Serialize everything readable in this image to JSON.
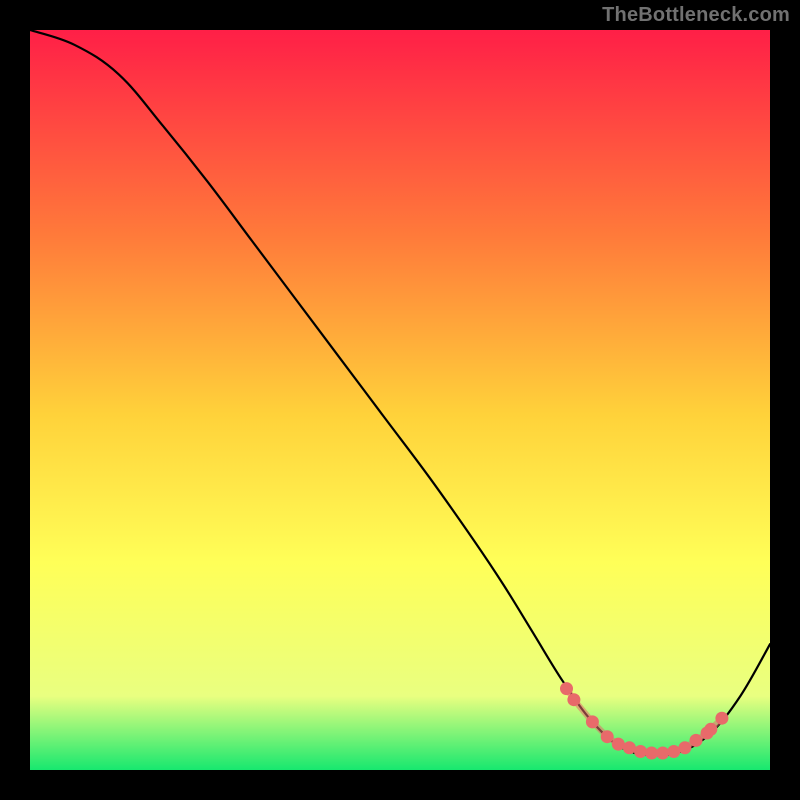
{
  "watermark": "TheBottleneck.com",
  "colors": {
    "background": "#000000",
    "gradient_top": "#ff1f47",
    "gradient_mid1": "#ff7b3a",
    "gradient_mid2": "#ffd23a",
    "gradient_mid3": "#ffff58",
    "gradient_mid4": "#e9ff80",
    "gradient_bottom": "#17e86f",
    "curve": "#000000",
    "dot": "#e86a6a"
  },
  "chart_data": {
    "type": "line",
    "title": "",
    "xlabel": "",
    "ylabel": "",
    "xlim": [
      0,
      100
    ],
    "ylim": [
      0,
      100
    ],
    "legend": false,
    "grid": false,
    "series": [
      {
        "name": "bottleneck-curve",
        "x": [
          0,
          6,
          12,
          18,
          24,
          30,
          36,
          42,
          48,
          54,
          60,
          64,
          68,
          72,
          76,
          80,
          84,
          88,
          92,
          96,
          100
        ],
        "y": [
          100,
          98,
          94,
          87,
          79.5,
          71.5,
          63.5,
          55.5,
          47.5,
          39.5,
          31,
          25,
          18.5,
          12,
          6.5,
          3,
          2,
          2.5,
          5,
          10,
          17
        ]
      }
    ],
    "annotations": [
      {
        "name": "highlight-dots",
        "points": [
          {
            "x": 72.5,
            "y": 11
          },
          {
            "x": 73.5,
            "y": 9.5
          },
          {
            "x": 76,
            "y": 6.5
          },
          {
            "x": 78,
            "y": 4.5
          },
          {
            "x": 79.5,
            "y": 3.5
          },
          {
            "x": 81,
            "y": 3
          },
          {
            "x": 82.5,
            "y": 2.5
          },
          {
            "x": 84,
            "y": 2.3
          },
          {
            "x": 85.5,
            "y": 2.3
          },
          {
            "x": 87,
            "y": 2.5
          },
          {
            "x": 88.5,
            "y": 3
          },
          {
            "x": 90,
            "y": 4
          },
          {
            "x": 91.5,
            "y": 5
          },
          {
            "x": 92,
            "y": 5.5
          },
          {
            "x": 93.5,
            "y": 7
          }
        ]
      }
    ]
  }
}
